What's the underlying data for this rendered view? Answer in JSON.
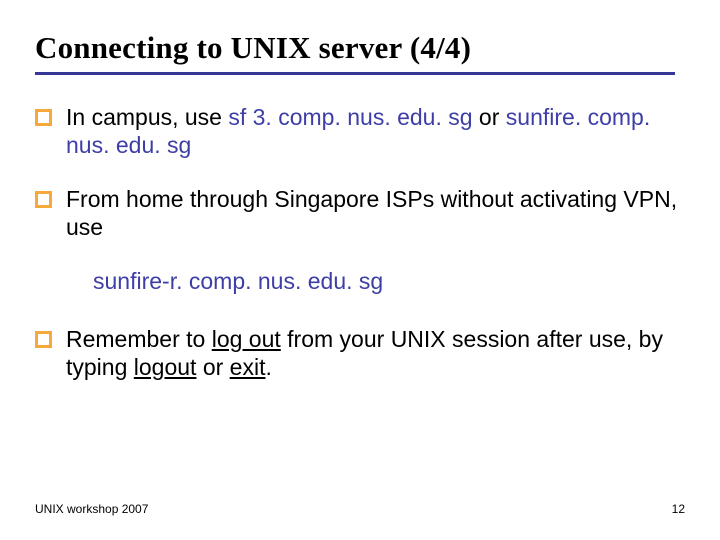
{
  "title": "Connecting to UNIX server (4/4)",
  "bullets": {
    "b1": {
      "pre": "In campus, use ",
      "h1": "sf 3. comp. nus. edu. sg",
      "mid": " or ",
      "h2": "sunfire. comp. nus. edu. sg"
    },
    "b2": {
      "text": "From home through Singapore ISPs without activating VPN, use"
    },
    "indent": {
      "text": "sunfire-r. comp. nus. edu. sg"
    },
    "b3": {
      "p1": "Remember to ",
      "u1": "log out",
      "p2": " from your UNIX session after use, by typing ",
      "u2": "logout",
      "p3": " or ",
      "u3": "exit",
      "p4": "."
    }
  },
  "footer": {
    "left": "UNIX workshop 2007",
    "right": "12"
  }
}
